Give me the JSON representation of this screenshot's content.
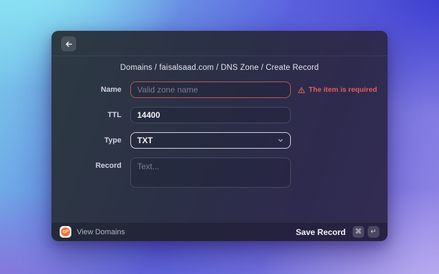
{
  "breadcrumb": {
    "text": "Domains / faisalsaad.com / DNS Zone / Create Record"
  },
  "form": {
    "name": {
      "label": "Name",
      "placeholder": "Valid zone name",
      "error": "The item is required"
    },
    "ttl": {
      "label": "TTL",
      "value": "14400"
    },
    "type": {
      "label": "Type",
      "value": "TXT"
    },
    "record": {
      "label": "Record",
      "placeholder": "Text..."
    }
  },
  "footer": {
    "cpanel_logo_text": "cP",
    "view_domains_label": "View Domains",
    "save_label": "Save Record",
    "shortcut_keys": [
      "⌘",
      "↵"
    ]
  },
  "icons": {
    "back": "arrow-left",
    "error": "warning-triangle",
    "type_select": "chevron-down"
  },
  "colors": {
    "error_red": "#e25c5c",
    "focused_border": "#d7d8e2",
    "cpanel_orange": "#ff6c2c",
    "bg_gradient": [
      "#8ce4f4",
      "#3a3cd0",
      "#8a74dc",
      "#bcaef0"
    ]
  }
}
